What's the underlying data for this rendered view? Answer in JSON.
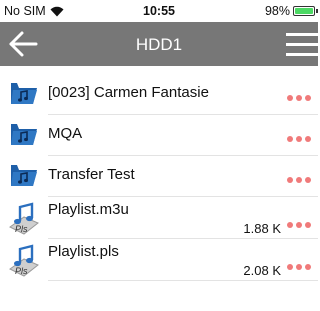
{
  "status_bar": {
    "carrier": "No SIM",
    "time": "10:55",
    "battery": "98%",
    "battery_level": 0.98,
    "battery_color": "#4cd964"
  },
  "header": {
    "title": "HDD1",
    "back_icon": "arrow-left-icon",
    "menu_icon": "hamburger-menu-icon",
    "background": "#777777"
  },
  "items": [
    {
      "name": "[0023] Carmen Fantasie",
      "type": "folder",
      "icon": "music-folder-icon",
      "size": ""
    },
    {
      "name": "MQA",
      "type": "folder",
      "icon": "music-folder-icon",
      "size": ""
    },
    {
      "name": "Transfer Test",
      "type": "folder",
      "icon": "music-folder-icon",
      "size": ""
    },
    {
      "name": "Playlist.m3u",
      "type": "playlist",
      "icon": "playlist-file-icon",
      "size": "1.88 K",
      "icon_label": "Pls"
    },
    {
      "name": "Playlist.pls",
      "type": "playlist",
      "icon": "playlist-file-icon",
      "size": "2.08 K",
      "icon_label": "Pls"
    }
  ],
  "more_icon": "more-dots-icon",
  "accent_dots": "#f07a7a"
}
